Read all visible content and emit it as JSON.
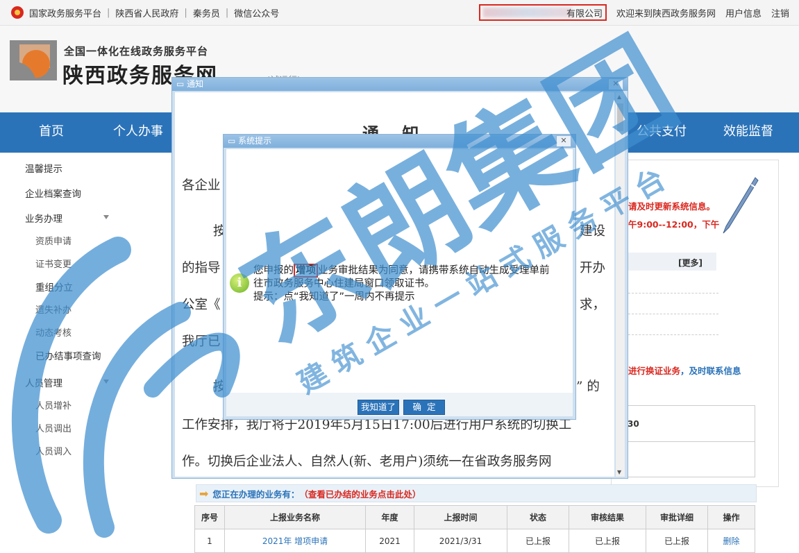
{
  "topbar": {
    "links": [
      "国家政务服务平台",
      "陕西省人民政府",
      "秦务员",
      "微信公众号"
    ],
    "company_suffix": "有限公司",
    "welcome": "欢迎来到陕西政务服务网",
    "user_info": "用户信息",
    "logout": "注销"
  },
  "header": {
    "platform": "全国一体化在线政务服务平台",
    "site_name": "陕西政务服务网",
    "trial": "(试运行)"
  },
  "nav": {
    "items": [
      "首页",
      "个人办事",
      "公共支付",
      "效能监督"
    ]
  },
  "sidebar": {
    "items": [
      {
        "label": "温馨提示"
      },
      {
        "label": "企业档案查询"
      },
      {
        "label": "业务办理"
      },
      {
        "label": "资质申请"
      },
      {
        "label": "证书变更"
      },
      {
        "label": "重组分立"
      },
      {
        "label": "遗失补办"
      },
      {
        "label": "动态考核"
      },
      {
        "label": "已办结事项查询"
      },
      {
        "label": "人员管理"
      },
      {
        "label": "人员增补"
      },
      {
        "label": "人员调出"
      },
      {
        "label": "人员调入"
      }
    ]
  },
  "right_panel": {
    "notice1": "请及时更新系统信息。",
    "notice2": "午9:00--12:00，下午",
    "more": "[更多]",
    "renew_red": "进行换证业务",
    "renew_blue": "，及时联系信息",
    "num_fragment": "30"
  },
  "business": {
    "heading": "您正在办理的业务有：",
    "heading_link": "（查看已办结的业务点击此处）",
    "columns": [
      "序号",
      "上报业务名称",
      "年度",
      "上报时间",
      "状态",
      "审核结果",
      "审批详细",
      "操作"
    ],
    "rows": [
      [
        "1",
        "2021年 增项申请",
        "2021",
        "2021/3/31",
        "已上报",
        "已上报",
        "已上报",
        "删除"
      ]
    ]
  },
  "notice_window": {
    "title": "通知",
    "heading": "通    知",
    "lines": [
      "各企业",
      "按",
      "建设",
      "的指导",
      "开办",
      "公室《",
      "求，",
      "我厅已",
      "按",
      "” 的",
      "工作安排，我厅将于2019年5月15日17:00后进行用户系统的切换工",
      "作。切换后企业法人、自然人(新、老用户)须统一在省政务服务网"
    ]
  },
  "dialog": {
    "title": "系统提示",
    "msg_pre": "您申报的",
    "msg_highlight": "增项",
    "msg_post": "业务审批结果为同意，请携带系统自动生成受理单前",
    "msg_line2": "往市政务服务中心住建局窗口领取证书。",
    "msg_line3": "提示：点“我知道了”一周内不再提示",
    "btn_know": "我知道了",
    "btn_ok": "确  定"
  },
  "watermark": {
    "brand": "东朗集团",
    "slogan": "建筑企业一站式服务平台"
  },
  "colors": {
    "nav_blue": "#2b73b9",
    "accent_red": "#d9281f",
    "watermark_blue": "#3f8fd0"
  }
}
